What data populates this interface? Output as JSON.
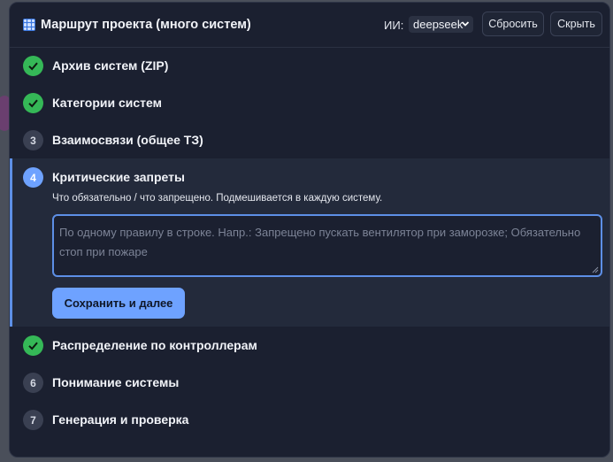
{
  "header": {
    "title": "Маршрут проекта (много систем)",
    "ai_label": "ИИ:",
    "ai_model": "deepseek",
    "reset_label": "Сбросить",
    "hide_label": "Скрыть"
  },
  "steps": [
    {
      "num": "1",
      "label": "Архив систем (ZIP)",
      "status": "done"
    },
    {
      "num": "2",
      "label": "Категории систем",
      "status": "done"
    },
    {
      "num": "3",
      "label": "Взаимосвязи (общее ТЗ)",
      "status": "todo"
    },
    {
      "num": "4",
      "label": "Критические запреты",
      "status": "active"
    },
    {
      "num": "5",
      "label": "Распределение по контроллерам",
      "status": "done"
    },
    {
      "num": "6",
      "label": "Понимание системы",
      "status": "todo"
    },
    {
      "num": "7",
      "label": "Генерация и проверка",
      "status": "todo"
    }
  ],
  "active_step": {
    "description": "Что обязательно / что запрещено. Подмешивается в каждую систему.",
    "placeholder": "По одному правилу в строке. Напр.: Запрещено пускать вентилятор при заморозке; Обязательно стоп при пожаре",
    "save_label": "Сохранить и далее"
  },
  "colors": {
    "done": "#35b857",
    "active": "#6ea2ff",
    "todo": "#3a4052",
    "panel": "#1b2030"
  }
}
